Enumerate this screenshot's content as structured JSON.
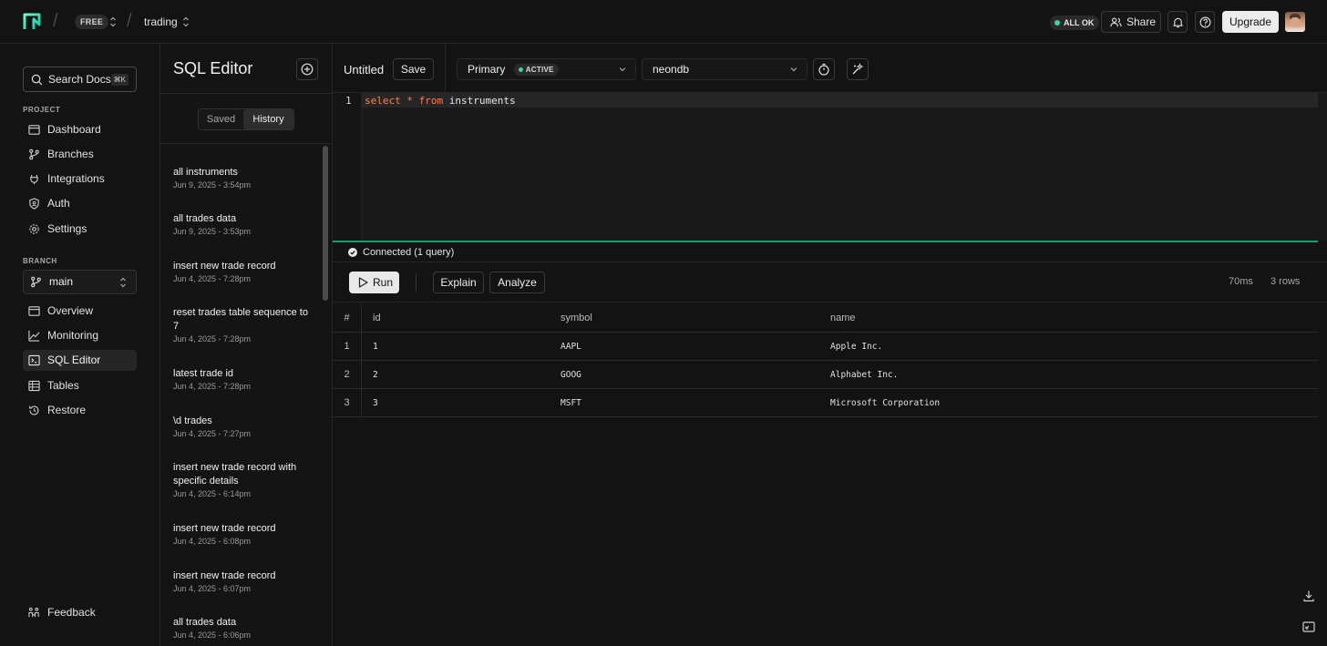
{
  "topbar": {
    "plan_badge": "FREE",
    "project": "trading",
    "status": "ALL OK",
    "share_label": "Share",
    "upgrade_label": "Upgrade"
  },
  "colors": {
    "accent_green": "#3ed598",
    "divider_green": "#11a36b",
    "keyword": "#ff7f50",
    "background": "#131313"
  },
  "leftnav": {
    "search_label": "Search Docs",
    "search_shortcut": "⌘K",
    "project_section": "PROJECT",
    "project_items": [
      {
        "label": "Dashboard",
        "icon": "dashboard-icon"
      },
      {
        "label": "Branches",
        "icon": "branches-icon"
      },
      {
        "label": "Integrations",
        "icon": "integrations-icon"
      },
      {
        "label": "Auth",
        "icon": "auth-shield-icon"
      },
      {
        "label": "Settings",
        "icon": "settings-gear-icon"
      }
    ],
    "branch_section": "BRANCH",
    "branch_value": "main",
    "branch_items": [
      {
        "label": "Overview",
        "icon": "overview-icon"
      },
      {
        "label": "Monitoring",
        "icon": "monitoring-chart-icon"
      },
      {
        "label": "SQL Editor",
        "icon": "sql-editor-icon",
        "active": true
      },
      {
        "label": "Tables",
        "icon": "tables-icon"
      },
      {
        "label": "Restore",
        "icon": "restore-icon"
      }
    ],
    "feedback_label": "Feedback"
  },
  "history_panel": {
    "title": "SQL Editor",
    "tabs": [
      "Saved",
      "History"
    ],
    "active_tab": "History",
    "items": [
      {
        "title": "all instruments",
        "date": "Jun 9, 2025 - 3:54pm"
      },
      {
        "title": "all trades data",
        "date": "Jun 9, 2025 - 3:53pm"
      },
      {
        "title": "insert new trade record",
        "date": "Jun 4, 2025 - 7:28pm"
      },
      {
        "title": "reset trades table sequence to 7",
        "date": "Jun 4, 2025 - 7:28pm"
      },
      {
        "title": "latest trade id",
        "date": "Jun 4, 2025 - 7:28pm"
      },
      {
        "title": "\\d trades",
        "date": "Jun 4, 2025 - 7:27pm"
      },
      {
        "title": "insert new trade record with specific details",
        "date": "Jun 4, 2025 - 6:14pm"
      },
      {
        "title": "insert new trade record",
        "date": "Jun 4, 2025 - 6:08pm"
      },
      {
        "title": "insert new trade record",
        "date": "Jun 4, 2025 - 6:07pm"
      },
      {
        "title": "all trades data",
        "date": "Jun 4, 2025 - 6:06pm"
      }
    ]
  },
  "editor": {
    "query_name": "Untitled",
    "save_label": "Save",
    "compute": "Primary",
    "compute_status": "ACTIVE",
    "database": "neondb",
    "line_number": "1",
    "code": {
      "kw1": "select",
      "star": "*",
      "kw2": "from",
      "table": "instruments"
    },
    "connection_status": "Connected (1 query)"
  },
  "actions": {
    "run_label": "Run",
    "explain_label": "Explain",
    "analyze_label": "Analyze",
    "duration": "70ms",
    "row_count": "3 rows"
  },
  "results": {
    "columns": [
      "#",
      "id",
      "symbol",
      "name"
    ],
    "rows": [
      {
        "n": "1",
        "id": "1",
        "symbol": "AAPL",
        "name": "Apple Inc."
      },
      {
        "n": "2",
        "id": "2",
        "symbol": "GOOG",
        "name": "Alphabet Inc."
      },
      {
        "n": "3",
        "id": "3",
        "symbol": "MSFT",
        "name": "Microsoft Corporation"
      }
    ]
  }
}
